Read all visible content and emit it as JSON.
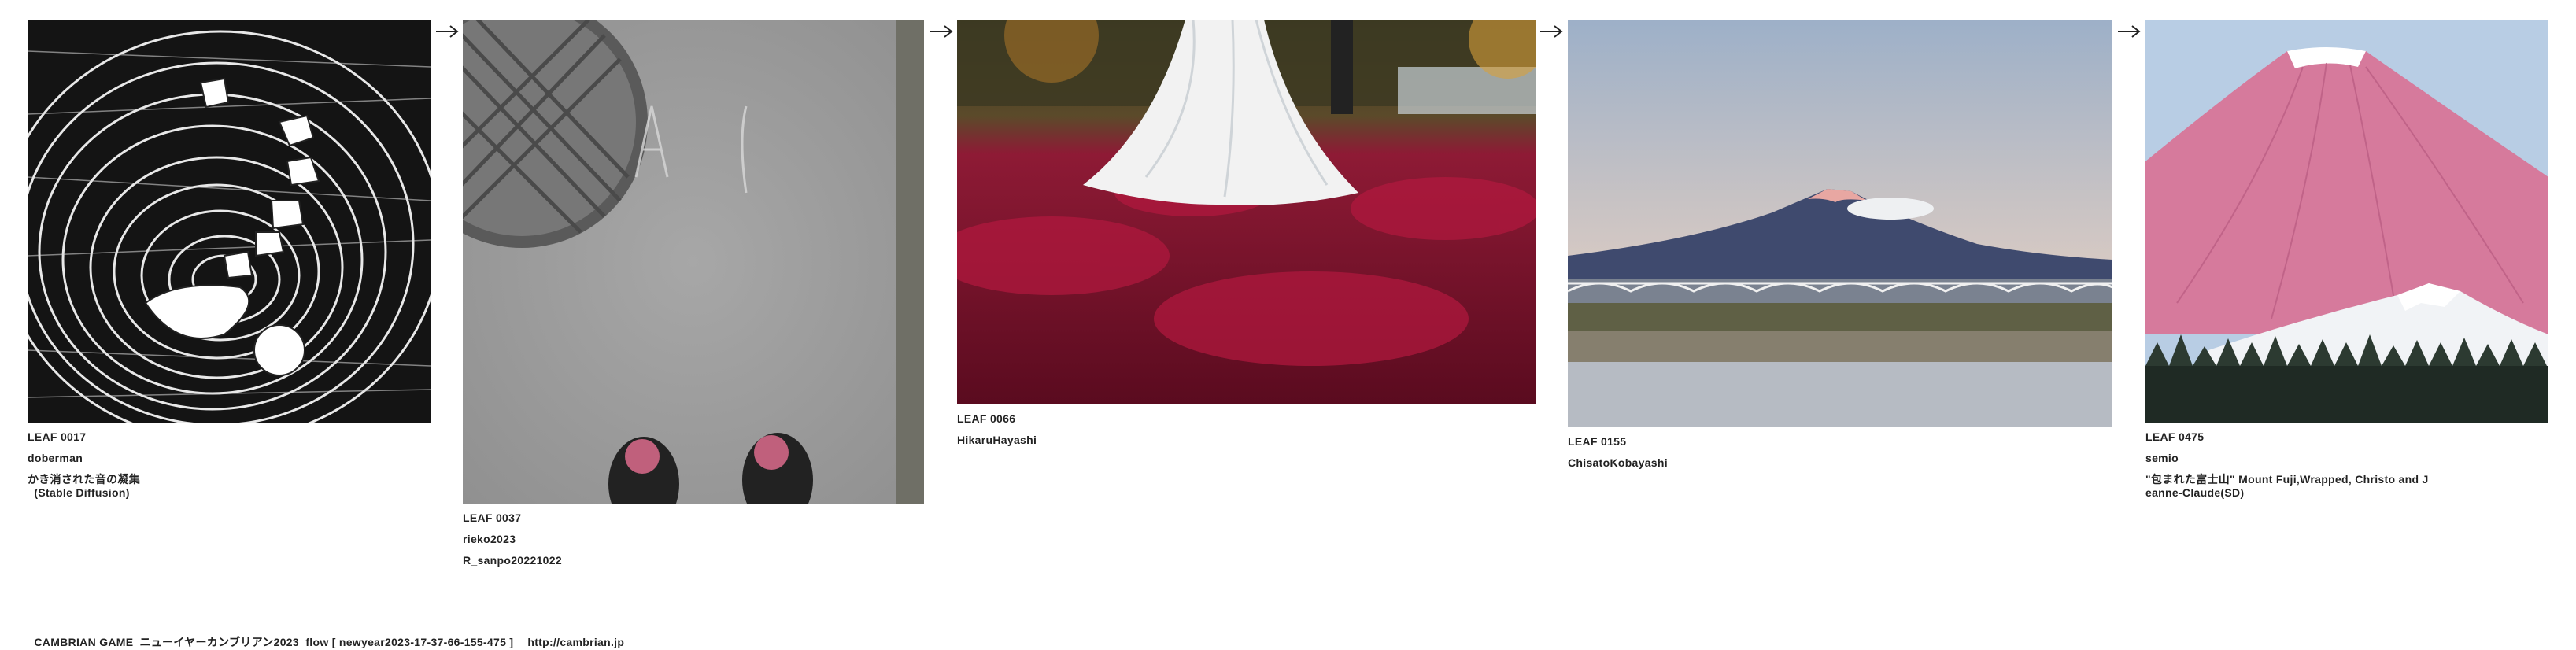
{
  "leaves": [
    {
      "id": "LEAF 0017",
      "author": "doberman",
      "title": "かき消された音の凝集\n  (Stable Diffusion)"
    },
    {
      "id": "LEAF 0037",
      "author": "rieko2023",
      "title": "R_sanpo20221022"
    },
    {
      "id": "LEAF 0066",
      "author": "HikaruHayashi",
      "title": ""
    },
    {
      "id": "LEAF 0155",
      "author": "ChisatoKobayashi",
      "title": ""
    },
    {
      "id": "LEAF 0475",
      "author": "semio",
      "title": "\"包まれた富士山\" Mount Fuji,Wrapped, Christo and J\neanne-Claude(SD)"
    }
  ],
  "arrow_icon": "arrow-right-icon",
  "footer": {
    "game": "CAMBRIAN GAME",
    "flow": "ニューイヤーカンブリアン2023  flow [ newyear2023-17-37-66-155-475 ]",
    "url": "http://cambrian.jp"
  },
  "colors": {
    "text": "#222222",
    "background": "#ffffff",
    "leaves_red": "#9a1434",
    "fuji_pink": "#d97a9c"
  }
}
